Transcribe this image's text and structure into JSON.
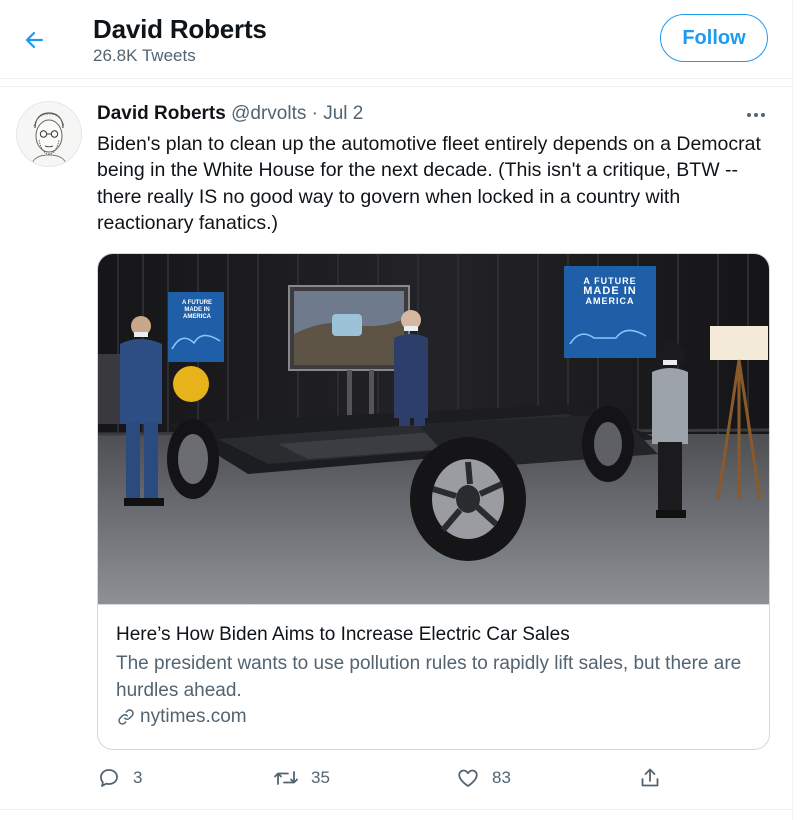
{
  "header": {
    "title": "David Roberts",
    "tweet_count": "26.8K Tweets",
    "follow_label": "Follow",
    "back_icon": "back-arrow-icon"
  },
  "tweet": {
    "author_name": "David Roberts",
    "handle": "@drvolts",
    "separator": "·",
    "date": "Jul 2",
    "text": "Biden's plan to clean up the automotive fleet entirely depends on a Democrat being in the White House for the next decade. (This isn't a critique, BTW -- there really IS no good way to govern when locked in a country with reactionary fanatics.)",
    "card": {
      "image_signs": [
        "A FUTURE",
        "MADE IN",
        "AMERICA"
      ],
      "title": "Here’s How Biden Aims to Increase Electric Car Sales",
      "description": "The president wants to use pollution rules to rapidly lift sales, but there are hurdles ahead.",
      "domain": "nytimes.com"
    },
    "actions": {
      "replies": "3",
      "retweets": "35",
      "likes": "83"
    }
  },
  "colors": {
    "accent": "#1d9bf0",
    "text_primary": "#0f1419",
    "text_secondary": "#536471",
    "border": "#cfd9de"
  }
}
